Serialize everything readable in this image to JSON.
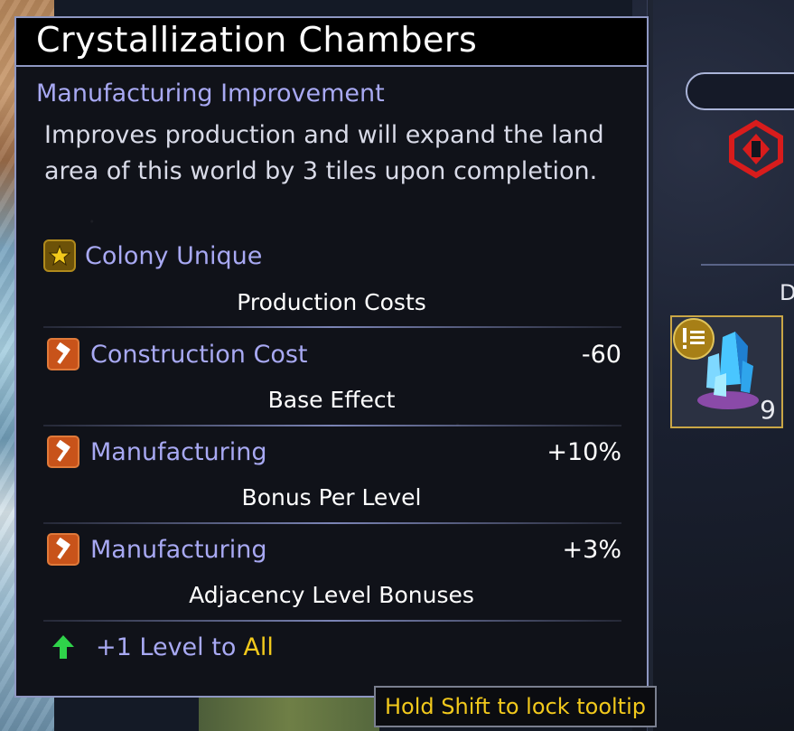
{
  "tooltip": {
    "title": "Crystallization Chambers",
    "subtitle": "Manufacturing Improvement",
    "description": "Improves production and will expand the land area of this world by 3 tiles upon completion.",
    "unique_label": "Colony Unique",
    "unique_icon": "star-icon",
    "sections": {
      "production_costs": {
        "title": "Production Costs",
        "rows": [
          {
            "icon": "hammer-icon",
            "label": "Construction Cost",
            "value": "-60"
          }
        ]
      },
      "base_effect": {
        "title": "Base Effect",
        "rows": [
          {
            "icon": "hammer-icon",
            "label": "Manufacturing",
            "value": "+10%"
          }
        ]
      },
      "bonus_per_level": {
        "title": "Bonus Per Level",
        "rows": [
          {
            "icon": "hammer-icon",
            "label": "Manufacturing",
            "value": "+3%"
          }
        ]
      },
      "adjacency": {
        "title": "Adjacency Level Bonuses",
        "prefix": "+1 Level to",
        "highlight": "All",
        "icon": "up-arrow-icon"
      }
    }
  },
  "hint": {
    "text": "Hold Shift to lock tooltip"
  },
  "side_panel": {
    "heading_letter": "D",
    "project_count": "9"
  },
  "colors": {
    "accent_lavender": "#a8a9f3",
    "accent_gold": "#f2c91c",
    "border": "#8e97c2",
    "hammer_orange": "#c8531a",
    "arrow_green": "#2fd34a",
    "emblem_red": "#d81c1c"
  }
}
